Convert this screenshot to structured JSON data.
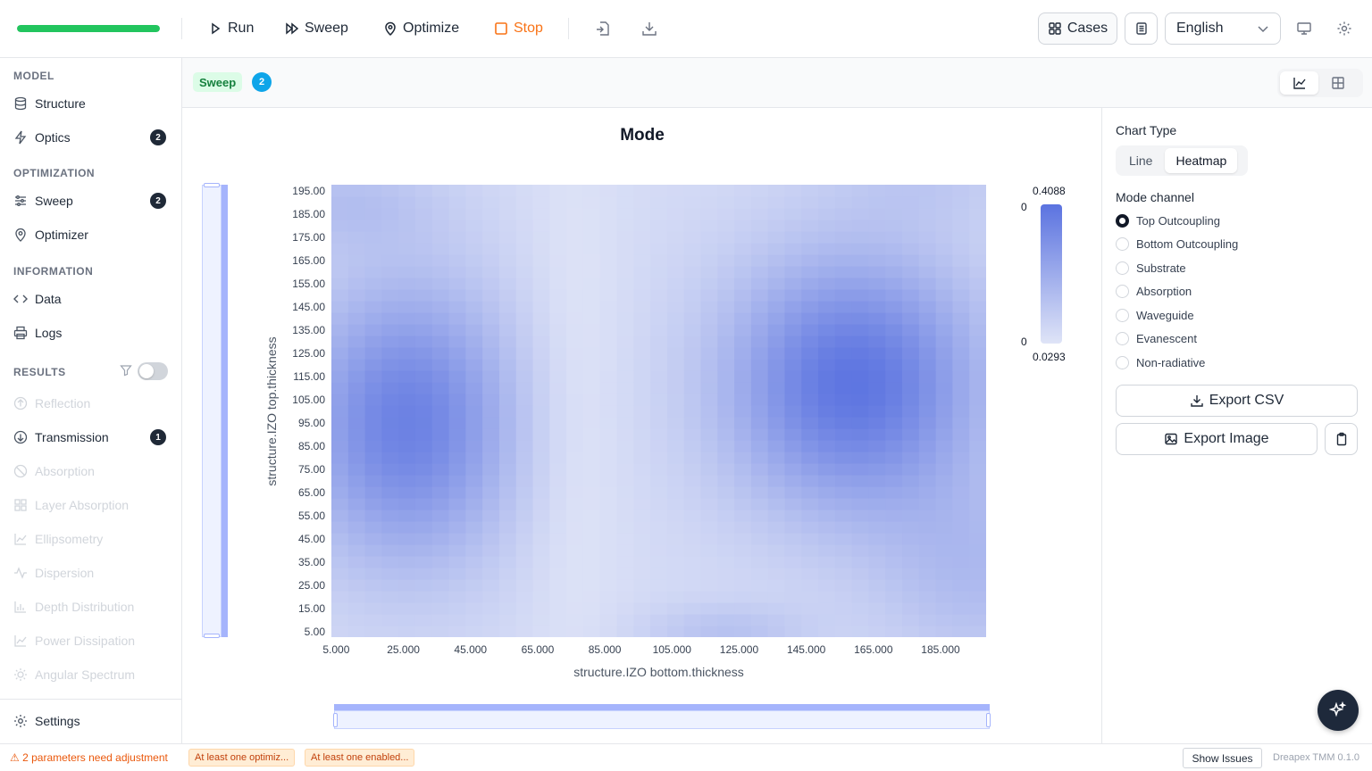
{
  "toolbar": {
    "progress": 1.0,
    "run_label": "Run",
    "sweep_label": "Sweep",
    "optimize_label": "Optimize",
    "stop_label": "Stop",
    "cases_label": "Cases",
    "language": "English"
  },
  "sidebar": {
    "sections": {
      "model": "MODEL",
      "optimization": "OPTIMIZATION",
      "information": "INFORMATION",
      "results": "RESULTS"
    },
    "model_items": [
      {
        "label": "Structure",
        "icon": "database-icon"
      },
      {
        "label": "Optics",
        "icon": "bolt-icon",
        "badge": "2"
      }
    ],
    "optimization_items": [
      {
        "label": "Sweep",
        "icon": "sliders-icon",
        "badge": "2"
      },
      {
        "label": "Optimizer",
        "icon": "pin-icon"
      }
    ],
    "information_items": [
      {
        "label": "Data",
        "icon": "code-icon"
      },
      {
        "label": "Logs",
        "icon": "printer-icon"
      }
    ],
    "results_items": [
      {
        "label": "Reflection",
        "icon": "arrow-up-circle-icon",
        "enabled": false
      },
      {
        "label": "Transmission",
        "icon": "arrow-down-circle-icon",
        "enabled": true,
        "badge": "1"
      },
      {
        "label": "Absorption",
        "icon": "ban-icon",
        "enabled": false
      },
      {
        "label": "Layer Absorption",
        "icon": "grid-icon",
        "enabled": false
      },
      {
        "label": "Ellipsometry",
        "icon": "chart-line-icon",
        "enabled": false
      },
      {
        "label": "Dispersion",
        "icon": "activity-icon",
        "enabled": false
      },
      {
        "label": "Depth Distribution",
        "icon": "bar-chart-icon",
        "enabled": false
      },
      {
        "label": "Power Dissipation",
        "icon": "chart-line-icon",
        "enabled": false
      },
      {
        "label": "Angular Spectrum",
        "icon": "sun-icon",
        "enabled": false
      }
    ],
    "settings_label": "Settings"
  },
  "subheader": {
    "tag": "Sweep",
    "count": "2"
  },
  "chart_data": {
    "type": "heatmap",
    "title": "Mode",
    "xlabel": "structure.IZO bottom.thickness",
    "ylabel": "structure.IZO top.thickness",
    "x_ticks": [
      "5.000",
      "25.000",
      "45.000",
      "65.000",
      "85.000",
      "105.000",
      "125.000",
      "145.000",
      "165.000",
      "185.000"
    ],
    "y_ticks": [
      "195.00",
      "185.00",
      "175.00",
      "165.00",
      "155.00",
      "145.00",
      "135.00",
      "125.00",
      "115.00",
      "105.00",
      "95.00",
      "85.00",
      "75.00",
      "65.00",
      "55.00",
      "45.00",
      "35.00",
      "25.00",
      "15.00",
      "5.00"
    ],
    "xlim": [
      5,
      200
    ],
    "ylim": [
      5,
      200
    ],
    "grid_step": 5,
    "value_range": [
      0.0293,
      0.4088
    ],
    "colorbar": {
      "max_label": "0.4088",
      "min_label": "0.0293",
      "upper_handle": "0",
      "lower_handle": "0"
    },
    "color_low": "#dfe4f7",
    "color_high": "#5b73e0"
  },
  "right_panel": {
    "chart_type_label": "Chart Type",
    "chart_types": [
      {
        "label": "Line",
        "active": false
      },
      {
        "label": "Heatmap",
        "active": true
      }
    ],
    "mode_channel_label": "Mode channel",
    "mode_channels": [
      {
        "label": "Top Outcoupling",
        "checked": true
      },
      {
        "label": "Bottom Outcoupling",
        "checked": false
      },
      {
        "label": "Substrate",
        "checked": false
      },
      {
        "label": "Absorption",
        "checked": false
      },
      {
        "label": "Waveguide",
        "checked": false
      },
      {
        "label": "Evanescent",
        "checked": false
      },
      {
        "label": "Non-radiative",
        "checked": false
      }
    ],
    "export_csv_label": "Export CSV",
    "export_image_label": "Export Image"
  },
  "statusbar": {
    "warning": "⚠ 2 parameters need adjustment",
    "chips": [
      "At least one optimiz...",
      "At least one enabled..."
    ],
    "show_issues_label": "Show Issues",
    "version": "Dreapex TMM 0.1.0"
  }
}
